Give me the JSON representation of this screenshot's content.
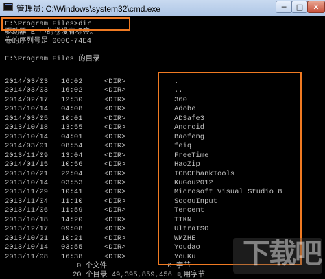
{
  "window": {
    "title": "管理员: C:\\Windows\\system32\\cmd.exe",
    "min_glyph": "─",
    "max_glyph": "□",
    "close_glyph": "✕"
  },
  "console": {
    "prompt_line": "E:\\Program Files>dir",
    "header_lines": [
      "驱动器 E 中的卷没有标签。",
      "卷的序列号是 000C-74E4",
      "",
      "E:\\Program Files 的目录"
    ],
    "entries": [
      {
        "date": "2014/03/03",
        "time": "16:02",
        "type": "<DIR>",
        "name": "."
      },
      {
        "date": "2014/03/03",
        "time": "16:02",
        "type": "<DIR>",
        "name": ".."
      },
      {
        "date": "2014/02/17",
        "time": "12:30",
        "type": "<DIR>",
        "name": "360"
      },
      {
        "date": "2013/10/14",
        "time": "04:08",
        "type": "<DIR>",
        "name": "Adobe"
      },
      {
        "date": "2014/03/05",
        "time": "10:01",
        "type": "<DIR>",
        "name": "ADSafe3"
      },
      {
        "date": "2013/10/18",
        "time": "13:55",
        "type": "<DIR>",
        "name": "Android"
      },
      {
        "date": "2013/10/14",
        "time": "04:01",
        "type": "<DIR>",
        "name": "Baofeng"
      },
      {
        "date": "2014/03/01",
        "time": "08:54",
        "type": "<DIR>",
        "name": "feiq"
      },
      {
        "date": "2013/11/09",
        "time": "13:04",
        "type": "<DIR>",
        "name": "FreeTime"
      },
      {
        "date": "2014/01/15",
        "time": "10:56",
        "type": "<DIR>",
        "name": "HaoZip"
      },
      {
        "date": "2013/10/21",
        "time": "22:04",
        "type": "<DIR>",
        "name": "ICBCEbankTools"
      },
      {
        "date": "2013/10/14",
        "time": "03:53",
        "type": "<DIR>",
        "name": "KuGou2012"
      },
      {
        "date": "2013/11/29",
        "time": "10:41",
        "type": "<DIR>",
        "name": "Microsoft Visual Studio 8"
      },
      {
        "date": "2013/11/04",
        "time": "11:10",
        "type": "<DIR>",
        "name": "SogouInput"
      },
      {
        "date": "2013/11/06",
        "time": "11:59",
        "type": "<DIR>",
        "name": "Tencent"
      },
      {
        "date": "2013/10/18",
        "time": "14:20",
        "type": "<DIR>",
        "name": "TTKN"
      },
      {
        "date": "2013/12/17",
        "time": "09:08",
        "type": "<DIR>",
        "name": "UltraISO"
      },
      {
        "date": "2013/10/21",
        "time": "10:21",
        "type": "<DIR>",
        "name": "WMZHE"
      },
      {
        "date": "2013/10/14",
        "time": "03:55",
        "type": "<DIR>",
        "name": "Youdao"
      },
      {
        "date": "2013/11/08",
        "time": "16:38",
        "type": "<DIR>",
        "name": "YouKu"
      }
    ],
    "summary_lines": [
      "0 个文件              0 字节",
      "20 个目录 49,395,859,456 可用字节"
    ]
  },
  "watermark": "下载吧",
  "colors": {
    "highlight": "#f07a22",
    "console_text": "#c0c0c0",
    "console_bg": "#000000"
  }
}
